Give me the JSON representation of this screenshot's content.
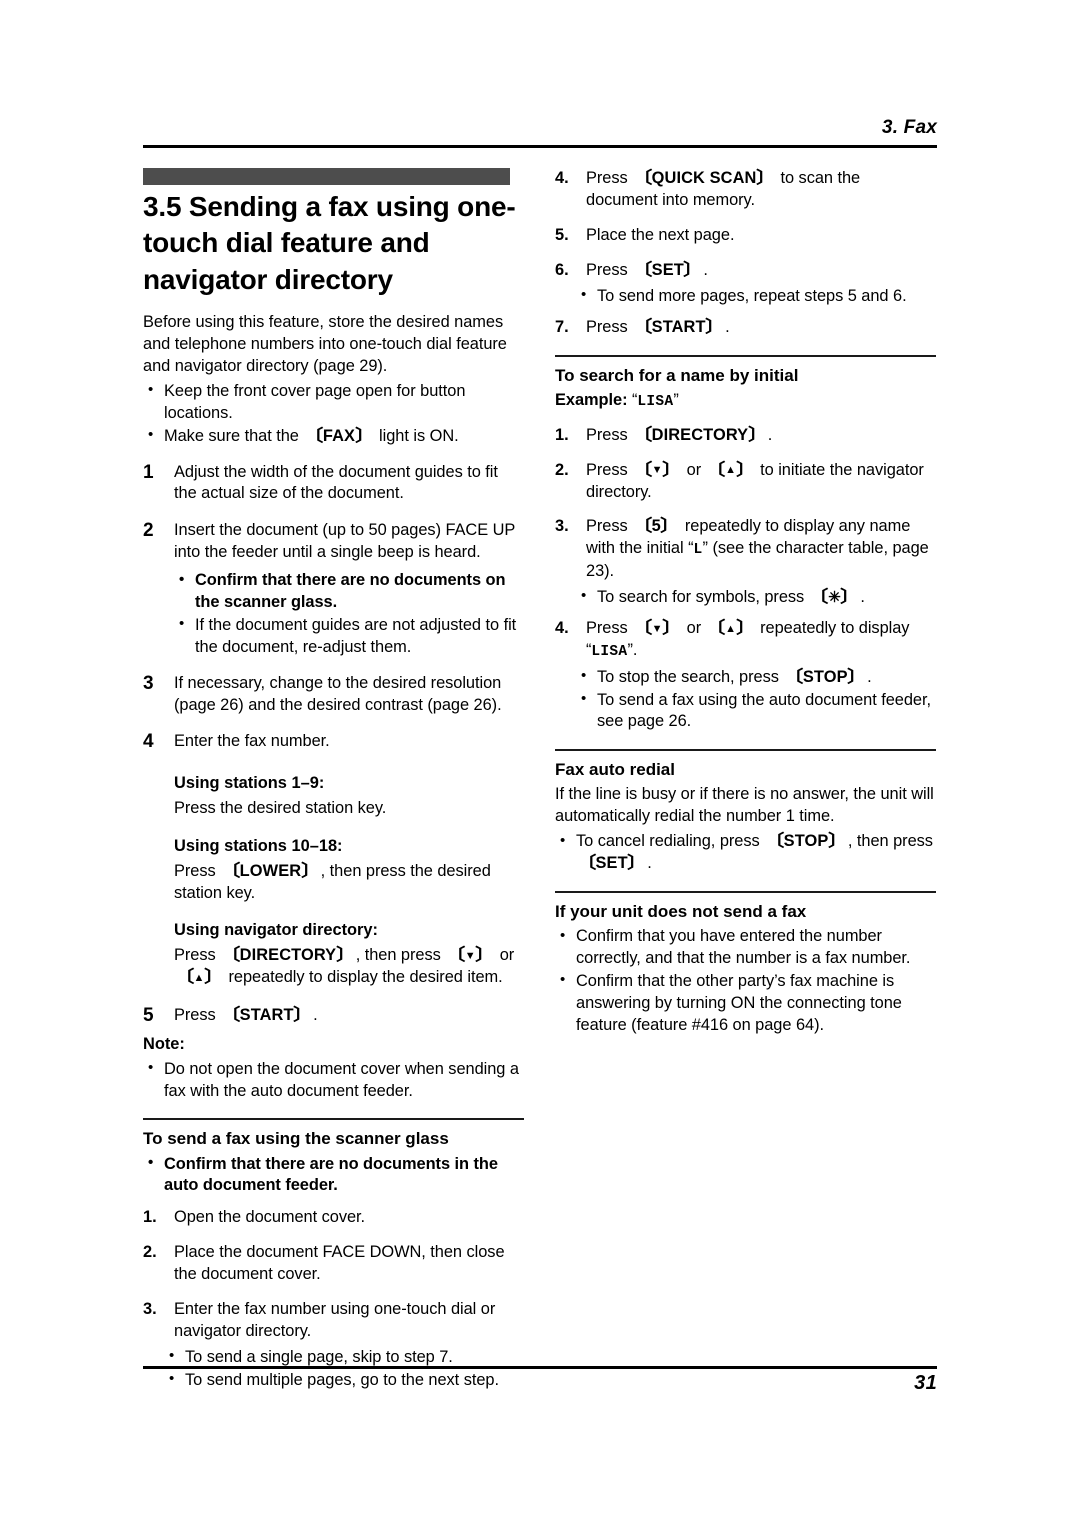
{
  "header": {
    "chapter_title": "3. Fax"
  },
  "footer": {
    "page_number": "31"
  },
  "left_column": {
    "section_number_title": "3.5 Sending a fax using one-touch dial feature and navigator directory",
    "intro_paragraph": "Before using this feature, store the desired names and telephone numbers into one-touch dial feature and navigator directory (page 29).",
    "intro_bullets": [
      "Keep the front cover page open for button locations.",
      "Make sure that the [FAX] light is ON."
    ],
    "intro_bullet_2_pre": "Make sure that the ",
    "intro_bullet_2_key": "FAX",
    "intro_bullet_2_post": " light is ON.",
    "steps": [
      {
        "num": "1",
        "text": "Adjust the width of the document guides to fit the actual size of the document."
      },
      {
        "num": "2",
        "text": "Insert the document (up to 50 pages) FACE UP into the feeder until a single beep is heard."
      },
      {
        "num": "3",
        "text": "If necessary, change to the desired resolution (page 26) and the desired contrast (page 26)."
      },
      {
        "num": "4",
        "text": "Enter the fax number."
      },
      {
        "num": "5",
        "text": "Press [START]."
      }
    ],
    "step2_bullets_bold": [
      "Confirm that there are no documents on the scanner glass."
    ],
    "step2_bullets_plain": [
      "If the document guides are not adjusted to fit the document, re-adjust them."
    ],
    "stations_1_9_heading": "Using stations 1–9:",
    "stations_1_9_text": "Press the desired station key.",
    "stations_10_18_heading": "Using stations 10–18:",
    "stations_10_18_pre": "Press ",
    "stations_10_18_key": "LOWER",
    "stations_10_18_post": ", then press the desired station key.",
    "navigator_heading": "Using navigator directory:",
    "navigator_pre": "Press ",
    "navigator_key": "DIRECTORY",
    "navigator_mid": ", then press ",
    "navigator_post": " repeatedly to display the desired item.",
    "step5_pre": "Press ",
    "step5_key": "START",
    "step5_post": ".",
    "note_heading": "Note:",
    "note_bullets": [
      "Do not open the document cover when sending a fax with the auto document feeder."
    ],
    "scanner_glass_heading": "To send a fax using the scanner glass",
    "scanner_glass_bold_bullets": [
      "Confirm that there are no documents in the auto document feeder."
    ],
    "scanner_glass_steps": [
      {
        "num": "1.",
        "text": "Open the document cover."
      },
      {
        "num": "2.",
        "text": "Place the document FACE DOWN, then close the document cover."
      },
      {
        "num": "3.",
        "text": "Enter the fax number using one-touch dial or navigator directory."
      }
    ],
    "scanner_glass_step3_bullets": [
      "To send a single page, skip to step 7.",
      "To send multiple pages, go to the next step."
    ]
  },
  "right_column": {
    "continued_steps": [
      {
        "num": "4.",
        "pre": "Press ",
        "key": "QUICK SCAN",
        "post": " to scan the document into memory."
      },
      {
        "num": "5.",
        "pre": "Place the next page.",
        "key": "",
        "post": ""
      },
      {
        "num": "6.",
        "pre": "Press ",
        "key": "SET",
        "post": "."
      },
      {
        "num": "7.",
        "pre": "Press ",
        "key": "START",
        "post": "."
      }
    ],
    "step6_bullets": [
      "To send more pages, repeat steps 5 and 6."
    ],
    "search_heading": "To search for a name by initial",
    "example_label": "Example: ",
    "example_value": "LISA",
    "search_steps": [
      {
        "num": "1.",
        "text": "Press [DIRECTORY]."
      },
      {
        "num": "2.",
        "text": "Press [▼] or [▲] to initiate the navigator directory."
      },
      {
        "num": "3.",
        "text": "Press [5] repeatedly to display any name with the initial “L” (see the character table, page 23)."
      },
      {
        "num": "4.",
        "text": "Press [▼] or [▲] repeatedly to display “LISA”."
      }
    ],
    "search_step1_pre": "Press ",
    "search_step1_key": "DIRECTORY",
    "search_step1_post": ".",
    "search_step2_pre": "Press ",
    "search_step2_mid": " or ",
    "search_step2_post": " to initiate the navigator directory.",
    "search_step3_pre": "Press ",
    "search_step3_key": "5",
    "search_step3_mid": " repeatedly to display any name with the initial “",
    "search_step3_initial": "L",
    "search_step3_post": "” (see the character table, page 23).",
    "search_step3_bullet_pre": "To search for symbols, press ",
    "search_step3_bullet_post": ".",
    "search_step4_pre": "Press ",
    "search_step4_mid": " or ",
    "search_step4_post": " repeatedly to display “",
    "search_step4_name": "LISA",
    "search_step4_end": "”.",
    "search_step4_bullets": [
      "To stop the search, press [STOP].",
      "To send a fax using the auto document feeder, see page 26."
    ],
    "search_step4_b1_pre": "To stop the search, press ",
    "search_step4_b1_key": "STOP",
    "search_step4_b1_post": ".",
    "search_step4_b2": "To send a fax using the auto document feeder, see page 26.",
    "redial_heading": "Fax auto redial",
    "redial_paragraph": "If the line is busy or if there is no answer, the unit will automatically redial the number 1 time.",
    "redial_bullet_pre": "To cancel redialing, press ",
    "redial_bullet_key1": "STOP",
    "redial_bullet_mid": ", then press ",
    "redial_bullet_key2": "SET",
    "redial_bullet_post": ".",
    "not_send_heading": "If your unit does not send a fax",
    "not_send_bullets": [
      "Confirm that you have entered the number correctly, and that the number is a fax number.",
      "Confirm that the other party’s fax machine is answering by turning ON the connecting tone feature (feature #416 on page 64)."
    ]
  },
  "icons": {
    "bracket_open": "〔",
    "bracket_close": "〕",
    "arrow_down": "▼",
    "arrow_up": "▲",
    "asterisk_key": "✳"
  }
}
